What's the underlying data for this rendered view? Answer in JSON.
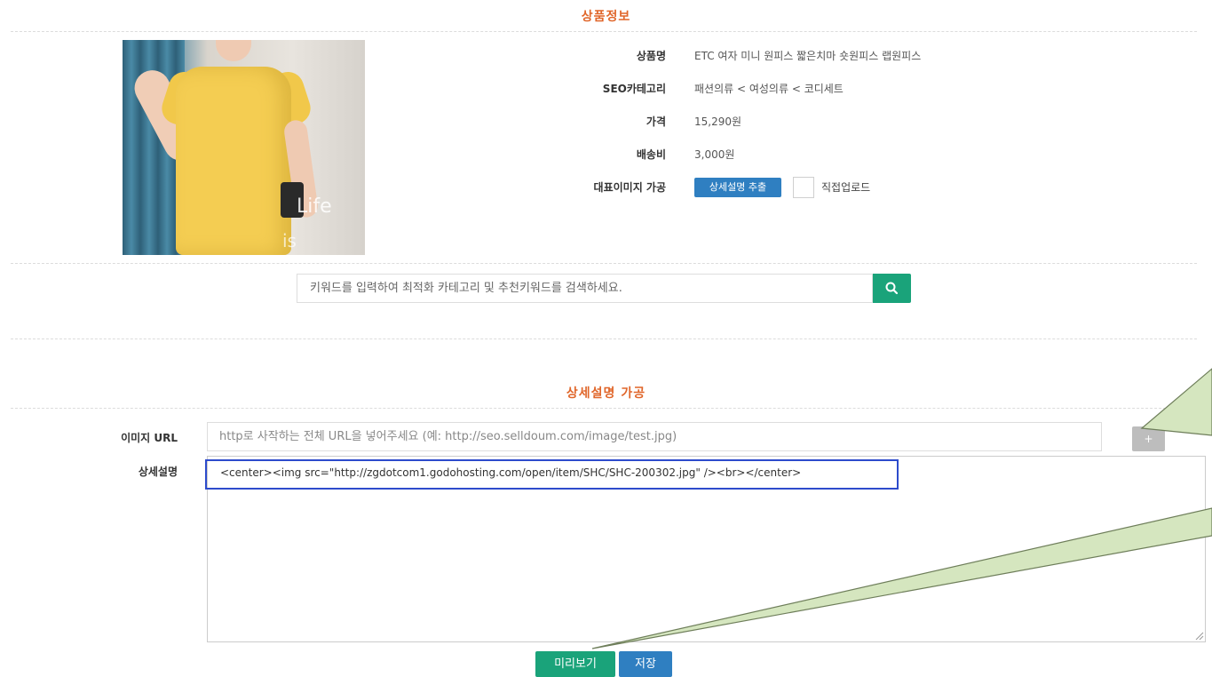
{
  "product_info": {
    "section_title": "상품정보",
    "rows": [
      {
        "label": "상품명",
        "value": "ETC 여자 미니 원피스 짧은치마 숏원피스 랩원피스"
      },
      {
        "label": "SEO카테고리",
        "value": "패션의류 < 여성의류 < 코디세트"
      },
      {
        "label": "가격",
        "value": "15,290원"
      },
      {
        "label": "배송비",
        "value": "3,000원"
      }
    ],
    "image_processing": {
      "label": "대표이미지 가공",
      "extract_button": "상세설명 추출",
      "direct_upload_label": "직접업로드"
    },
    "photo_text": {
      "line1": "Life",
      "line2": "is"
    }
  },
  "search": {
    "placeholder": "키워드를 입력하여 최적화 카테고리 및 추천키워드를 검색하세요.",
    "icon": "search-icon"
  },
  "detail": {
    "section_title": "상세설명 가공",
    "image_url_label": "이미지 URL",
    "image_url_placeholder": "http로 사작하는 전체 URL을 넣어주세요 (예: http://seo.selldoum.com/image/test.jpg)",
    "add_button": "+",
    "description_label": "상세설명",
    "description_value": "<center><img src=\"http://zgdotcom1.godohosting.com/open/item/SHC/SHC-200302.jpg\" /><br></center>"
  },
  "actions": {
    "preview_button": "미리보기",
    "save_button": "저장"
  },
  "colors": {
    "section_title": "#e0662a",
    "green": "#1aa37a",
    "blue": "#2f7fc1",
    "highlight_border": "#2d4bcc",
    "callout_fill": "#d5e6bf"
  }
}
